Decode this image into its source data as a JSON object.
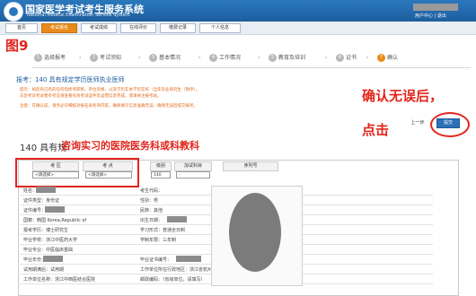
{
  "header": {
    "title": "国家医学考试考生服务系统",
    "subtitle": "National Medical Examination Service System",
    "user_links": "用户中心 | 退出"
  },
  "nav": {
    "tabs": [
      "首页",
      "考试报名",
      "考试成绩",
      "在线评价",
      "缴费记录",
      "个人信息"
    ],
    "active_index": 1
  },
  "figure_label": "图9",
  "steps": [
    {
      "num": "1",
      "label": "选择报考"
    },
    {
      "num": "2",
      "label": "考试须知"
    },
    {
      "num": "3",
      "label": "基本情况"
    },
    {
      "num": "4",
      "label": "工作情况"
    },
    {
      "num": "5",
      "label": "教育及培训"
    },
    {
      "num": "6",
      "label": "证书"
    },
    {
      "num": "7",
      "label": "确认"
    }
  ],
  "apply": {
    "line": "报考：140 具有规定学历医师执业医师",
    "note1": "提示：如您有已有的任何指修考职称，单位资格，以及学历在本学历在校（当年毕业研究生（暂停）。",
    "note2": "与您考试考试者有考证请查看有效考试证件及运营信息完成，或请关注报考站。",
    "note3": "注意：在确认前，请务必仔细核对报名表各项内容，确保填写信息准确无误，确保无误后提交报考。"
  },
  "annotations": {
    "confirm_line1": "确认无误后，",
    "confirm_line2": "点击",
    "consult": "咨询实习的医院医务科或科教科"
  },
  "buttons": {
    "prev": "上一步",
    "submit": "提交"
  },
  "hosp_title": "140 具有规",
  "table": {
    "headers": [
      "考 区",
      "考 点",
      "级别",
      "加试科目",
      "序列号"
    ],
    "selects": [
      "<请选择>",
      "<请选择>",
      "140",
      "-"
    ],
    "rows": [
      {
        "l1": "姓名：",
        "l2": "考生代码："
      },
      {
        "l1": "证件类型：身份证",
        "l2": "性别：男"
      },
      {
        "l1": "证件编号：",
        "l2": "民族：其他"
      },
      {
        "l1": "国籍：韩国 Korea,Republic of",
        "l2": "出生日期："
      },
      {
        "l1": "报考学历：博士研究生",
        "l2": "学习形式：普通全日制"
      },
      {
        "l1": "毕业学校：浙江中医药大学",
        "l2": "学制年限：三年制"
      },
      {
        "l1": "毕业专业：中医临床基础",
        "l2": ""
      },
      {
        "l1": "毕业年份：",
        "l2": "毕业证书编号："
      },
      {
        "l1": "试用期满后：试用期",
        "l2": "工作单位所在行政地区：浙江省杭州市"
      },
      {
        "l1": "工作单位名称：浙江中西医结合医院",
        "l2": "邮政编码：（省级单位，请填写）"
      }
    ]
  },
  "colors": {
    "accent": "#e88a1a",
    "brand": "#2b78bd",
    "annotation": "#e1251b"
  }
}
